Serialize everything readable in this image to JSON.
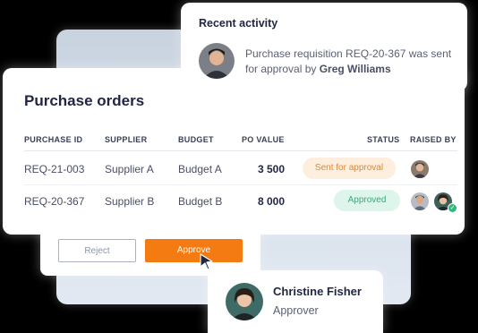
{
  "activity": {
    "title": "Recent activity",
    "message_prefix": "Purchase requisition REQ-20-367 was sent for approval by ",
    "message_user": "Greg Williams"
  },
  "purchase_orders": {
    "title": "Purchase orders",
    "columns": [
      "PURCHASE ID",
      "SUPPLIER",
      "BUDGET",
      "PO VALUE",
      "STATUS",
      "RAISED BY"
    ],
    "rows": [
      {
        "id": "REQ-21-003",
        "supplier": "Supplier A",
        "budget": "Budget A",
        "value": "3 500",
        "status": "Sent for approval"
      },
      {
        "id": "REQ-20-367",
        "supplier": "Supplier B",
        "budget": "Budget B",
        "value": "8 000",
        "status": "Approved"
      }
    ]
  },
  "actions": {
    "reject_label": "Reject",
    "approve_label": "Approve"
  },
  "approver": {
    "name": "Christine Fisher",
    "role": "Approver"
  },
  "colors": {
    "accent_orange": "#f47a12",
    "sent_pill_bg": "#fdeedd",
    "sent_pill_text": "#d98a3a",
    "approved_pill_bg": "#ddf5ea",
    "approved_pill_text": "#3aa97a",
    "title_navy": "#1f2544"
  },
  "icons": {
    "cursor": "pointer-cursor-icon",
    "approved_check": "check-badge-icon"
  }
}
